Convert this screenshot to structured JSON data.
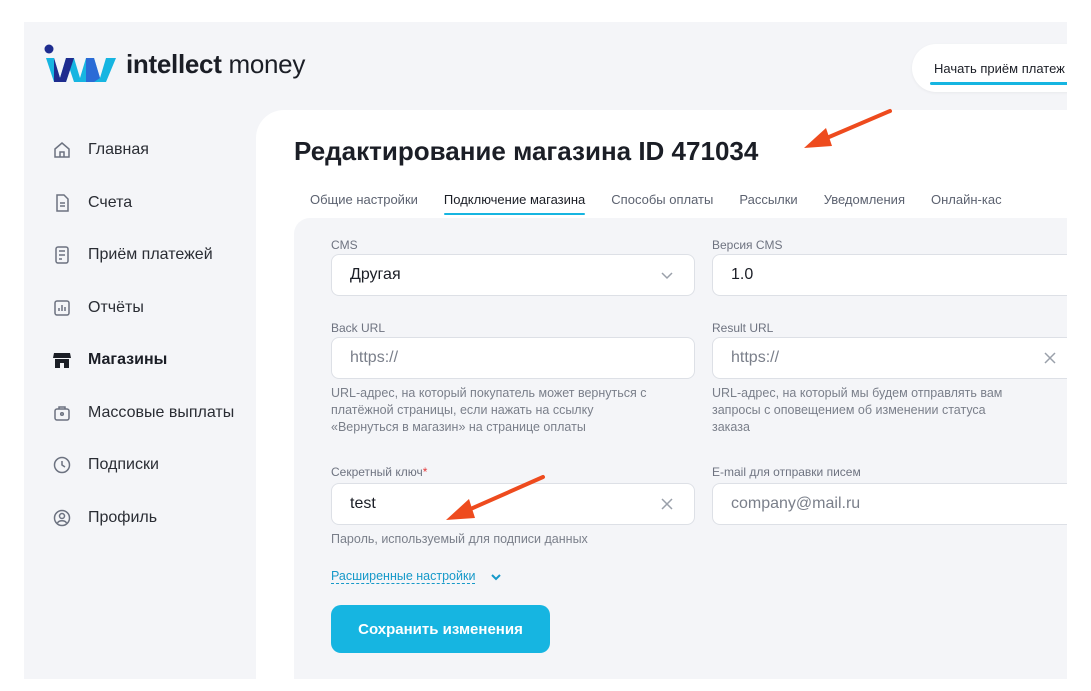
{
  "brand": {
    "bold": "intellect",
    "regular": "money",
    "accent": "#16b5e1",
    "logo_colors": [
      "#1e2c8f",
      "#16b5e1",
      "#2a6bd6"
    ]
  },
  "header": {
    "cta_label": "Начать приём платеж"
  },
  "sidebar": {
    "items": [
      {
        "label": "Главная",
        "icon": "home-icon"
      },
      {
        "label": "Счета",
        "icon": "document-icon"
      },
      {
        "label": "Приём платежей",
        "icon": "terminal-icon"
      },
      {
        "label": "Отчёты",
        "icon": "chart-icon"
      },
      {
        "label": "Магазины",
        "icon": "store-icon",
        "active": true
      },
      {
        "label": "Массовые выплаты",
        "icon": "wallet-icon"
      },
      {
        "label": "Подписки",
        "icon": "clock-icon"
      },
      {
        "label": "Профиль",
        "icon": "user-icon"
      }
    ]
  },
  "page": {
    "title": "Редактирование магазина ID 471034"
  },
  "tabs": [
    {
      "label": "Общие настройки"
    },
    {
      "label": "Подключение магазина",
      "active": true
    },
    {
      "label": "Способы оплаты"
    },
    {
      "label": "Рассылки"
    },
    {
      "label": "Уведомления"
    },
    {
      "label": "Онлайн-кас"
    }
  ],
  "form": {
    "cms": {
      "label": "CMS",
      "value": "Другая"
    },
    "cms_version": {
      "label": "Версия CMS",
      "value": "1.0"
    },
    "back_url": {
      "label": "Back URL",
      "placeholder": "https://",
      "hint": [
        "URL-адрес, на который покупатель может вернуться с",
        "платёжной страницы, если нажать на ссылку",
        "«Вернуться в магазин» на странице оплаты"
      ]
    },
    "result_url": {
      "label": "Result URL",
      "placeholder": "https://",
      "hint": [
        "URL-адрес, на который мы будем отправлять вам",
        "запросы с оповещением об изменении статуса",
        "заказа"
      ]
    },
    "secret_key": {
      "label": "Секретный ключ",
      "required_mark": "*",
      "value": "test",
      "hint": "Пароль, используемый для подписи данных"
    },
    "email": {
      "label": "E-mail для отправки писем",
      "placeholder": "company@mail.ru"
    },
    "advanced_link": "Расширенные настройки",
    "save_label": "Сохранить изменения"
  },
  "annotation_color": "#ee4b1e"
}
